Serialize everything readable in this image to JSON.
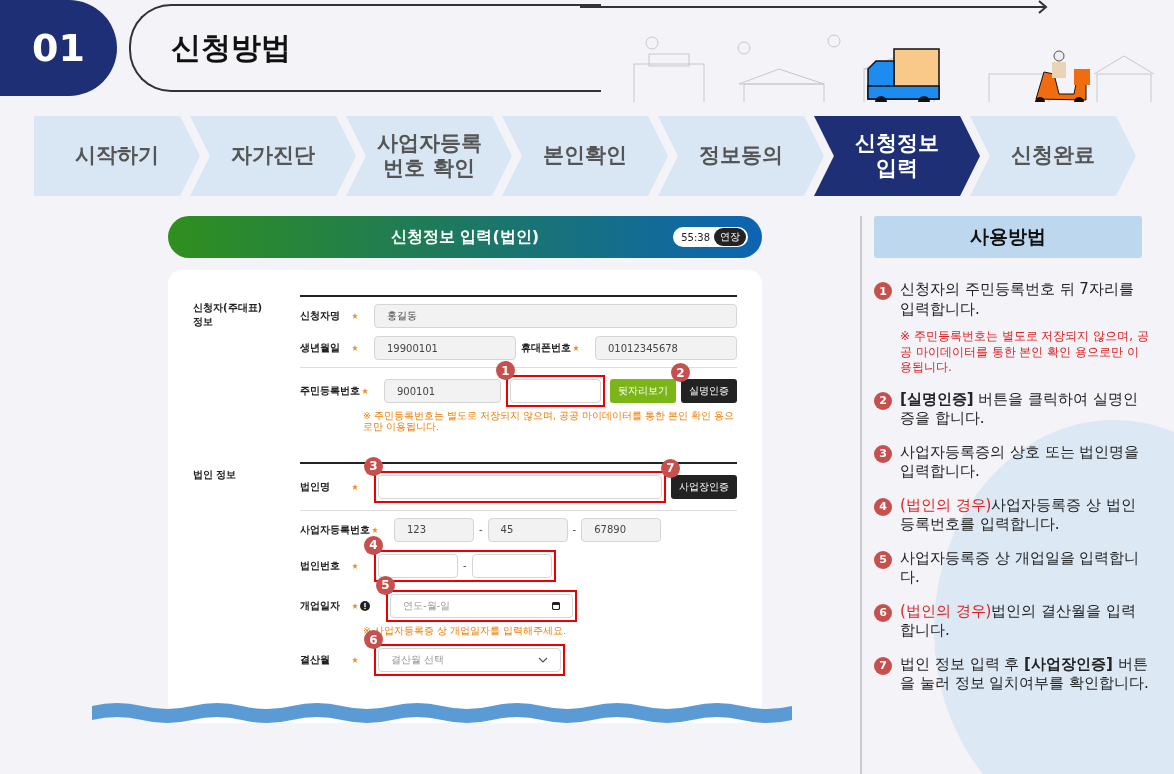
{
  "header": {
    "number": "01",
    "title": "신청방법"
  },
  "steps": [
    {
      "lines": [
        "시작하기"
      ],
      "selected": false
    },
    {
      "lines": [
        "자가진단"
      ],
      "selected": false
    },
    {
      "lines": [
        "사업자등록",
        "번호 확인"
      ],
      "selected": false
    },
    {
      "lines": [
        "본인확인"
      ],
      "selected": false
    },
    {
      "lines": [
        "정보동의"
      ],
      "selected": false
    },
    {
      "lines": [
        "신청정보",
        "입력"
      ],
      "selected": true
    },
    {
      "lines": [
        "신청완료"
      ],
      "selected": false
    }
  ],
  "form": {
    "title": "신청정보 입력(법인)",
    "timer": "55:38",
    "extend_button": "연장",
    "sections": [
      {
        "lines": [
          "신청자(주대표)",
          "정보"
        ],
        "groups": [
          [
            {
              "items": [
                {
                  "kind": "label",
                  "text": "신청자명",
                  "required": true
                },
                {
                  "kind": "input",
                  "value": "홍길동"
                }
              ]
            },
            {
              "items": [
                {
                  "kind": "label",
                  "text": "생년월일",
                  "required": true
                },
                {
                  "kind": "input",
                  "value": "19900101"
                },
                {
                  "kind": "label",
                  "text": "휴대폰번호",
                  "required": true
                },
                {
                  "kind": "input",
                  "value": "01012345678"
                }
              ]
            }
          ],
          [
            {
              "items": [
                {
                  "kind": "label",
                  "text": "주민등록번호",
                  "required": true
                },
                {
                  "kind": "input",
                  "value": "900101"
                },
                {
                  "kind": "group",
                  "callout": "1",
                  "items": [
                    {
                      "kind": "input",
                      "value": ""
                    }
                  ]
                },
                {
                  "kind": "button",
                  "text": "뒷자리보기"
                },
                {
                  "kind": "button",
                  "text": "실명인증",
                  "badge": "2"
                }
              ],
              "note": "※ 주민등록번호는 별도로 저장되지 않으며, 공공 마이데이터를 통한 본인 확인 용으로만 이용됩니다."
            }
          ]
        ]
      },
      {
        "lines": [
          "법인 정보"
        ],
        "groups": [
          [
            {
              "items": [
                {
                  "kind": "label",
                  "text": "법인명",
                  "required": true
                },
                {
                  "kind": "group",
                  "callout": "3",
                  "items": [
                    {
                      "kind": "input",
                      "value": ""
                    }
                  ]
                },
                {
                  "kind": "button",
                  "text": "사업장인증",
                  "badge": "7"
                }
              ]
            }
          ],
          [
            {
              "items": [
                {
                  "kind": "label",
                  "text": "사업자등록번호",
                  "required": true
                },
                {
                  "kind": "input",
                  "value": "123"
                },
                {
                  "kind": "dash",
                  "text": "-"
                },
                {
                  "kind": "input",
                  "value": "45"
                },
                {
                  "kind": "dash",
                  "text": "-"
                },
                {
                  "kind": "input",
                  "value": "67890"
                }
              ]
            },
            {
              "items": [
                {
                  "kind": "label",
                  "text": "법인번호",
                  "required": true
                },
                {
                  "kind": "group",
                  "callout": "4",
                  "items": [
                    {
                      "kind": "input",
                      "value": ""
                    },
                    {
                      "kind": "dash",
                      "text": "-"
                    },
                    {
                      "kind": "input",
                      "value": ""
                    }
                  ]
                }
              ]
            },
            {
              "items": [
                {
                  "kind": "label",
                  "text": "개업일자",
                  "required": true,
                  "info": true
                },
                {
                  "kind": "group",
                  "callout": "5",
                  "items": [
                    {
                      "kind": "date",
                      "placeholder": "연도-월-일"
                    }
                  ]
                }
              ],
              "note": "※ 사업자등록증 상 개업일자를 입력해주세요."
            },
            {
              "items": [
                {
                  "kind": "label",
                  "text": "결산월",
                  "required": true
                },
                {
                  "kind": "group",
                  "callout": "6",
                  "items": [
                    {
                      "kind": "select",
                      "placeholder": "결산월 선택"
                    }
                  ]
                }
              ]
            }
          ]
        ]
      }
    ]
  },
  "guide": {
    "title": "사용방법",
    "items": [
      {
        "number": "1",
        "text": "신청자의 주민등록번호 뒤 7자리를 입력합니다.",
        "note": "※ 주민등록번호는 별도로 저장되지 않으며, 공공 마이데이터를 통한 본인 확인 용으로만 이용됩니다."
      },
      {
        "number": "2",
        "text": "**[실명인증]** 버튼을 클릭하여 실명인증을 합니다."
      },
      {
        "number": "3",
        "text": "사업자등록증의 상호 또는 법인명을 입력합니다."
      },
      {
        "number": "4",
        "prefix": "(법인의 경우)",
        "text": "사업자등록증 상 법인등록번호를 입력합니다."
      },
      {
        "number": "5",
        "text": "사업자등록증 상 개업일을 입력합니다."
      },
      {
        "number": "6",
        "prefix": "(법인의 경우)",
        "text": "법인의 결산월을 입력합니다."
      },
      {
        "number": "7",
        "text": "법인 정보 입력 후 **[사업장인증]** 버튼을 눌러 정보 일치여부를 확인합니다."
      }
    ]
  }
}
